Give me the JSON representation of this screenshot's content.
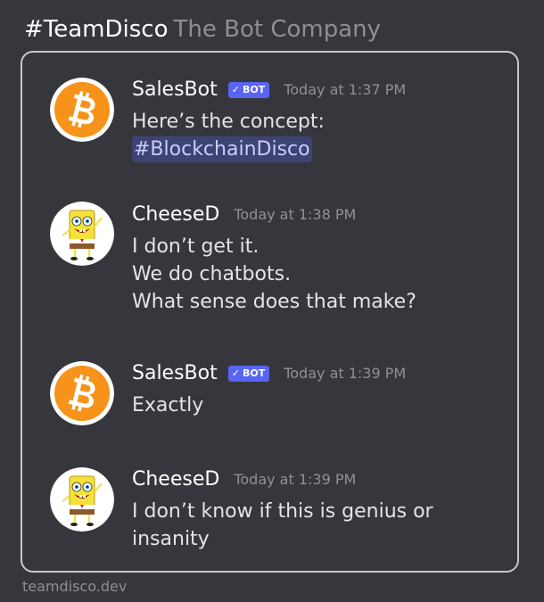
{
  "header": {
    "team": "#TeamDisco",
    "company": "The Bot Company"
  },
  "messages": [
    {
      "username": "SalesBot",
      "is_bot": true,
      "bot_label": "BOT",
      "timestamp": "Today at 1:37 PM",
      "avatar": "bitcoin-icon",
      "lines": [
        "Here’s the concept:"
      ],
      "hashtag": "#BlockchainDisco"
    },
    {
      "username": "CheeseD",
      "is_bot": false,
      "timestamp": "Today at 1:38 PM",
      "avatar": "spongebob-avatar",
      "lines": [
        "I don’t get it.",
        "We do chatbots.",
        "What sense does that make?"
      ]
    },
    {
      "username": "SalesBot",
      "is_bot": true,
      "bot_label": "BOT",
      "timestamp": "Today at 1:39 PM",
      "avatar": "bitcoin-icon",
      "lines": [
        "Exactly"
      ]
    },
    {
      "username": "CheeseD",
      "is_bot": false,
      "timestamp": "Today at 1:39 PM",
      "avatar": "spongebob-avatar",
      "lines": [
        "I don’t know if this is genius or",
        "insanity"
      ]
    }
  ],
  "footer": {
    "site": "teamdisco.dev"
  },
  "colors": {
    "background": "#36373c",
    "bot_tag": "#5865f2",
    "bitcoin": "#f7931a",
    "hashtag_bg": "#3e4376"
  }
}
